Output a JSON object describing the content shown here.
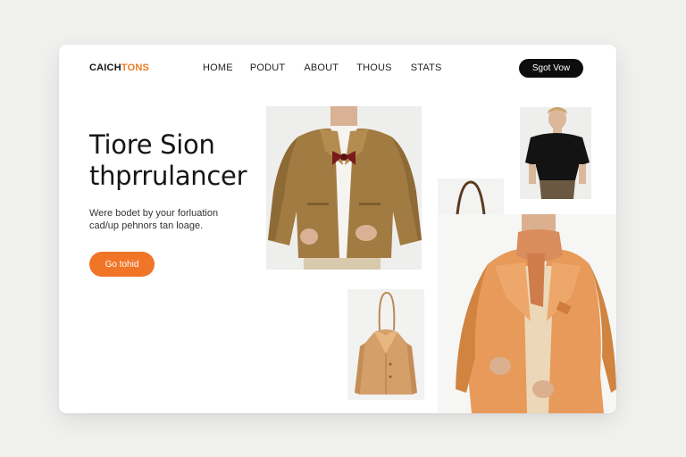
{
  "brand": {
    "text_dark": "CAICH",
    "text_accent": "TONS"
  },
  "nav": {
    "items": [
      "HOME",
      "PODUT",
      "ABOUT",
      "THOUS",
      "STATS"
    ]
  },
  "header_cta": {
    "label": "Sgot Vow"
  },
  "hero": {
    "title_lines": [
      "Tiore Sion",
      "thprrulancer"
    ],
    "subtitle_lines": [
      "Were bodet by your forluation",
      "cad/up pehnors tan loage."
    ],
    "cta_label": "Go tohid"
  },
  "colors": {
    "accent": "#f07527",
    "dark_button": "#0d0d0d",
    "background": "#f1f1f0",
    "card": "#ffffff"
  },
  "images": [
    {
      "name": "man-brown-jacket-photo",
      "icon": "photo"
    },
    {
      "name": "leopard-tote-bag-photo",
      "icon": "photo"
    },
    {
      "name": "woman-black-top-photo",
      "icon": "photo"
    },
    {
      "name": "tan-coat-hanger-photo",
      "icon": "photo"
    },
    {
      "name": "orange-coat-scarf-photo",
      "icon": "photo"
    }
  ]
}
